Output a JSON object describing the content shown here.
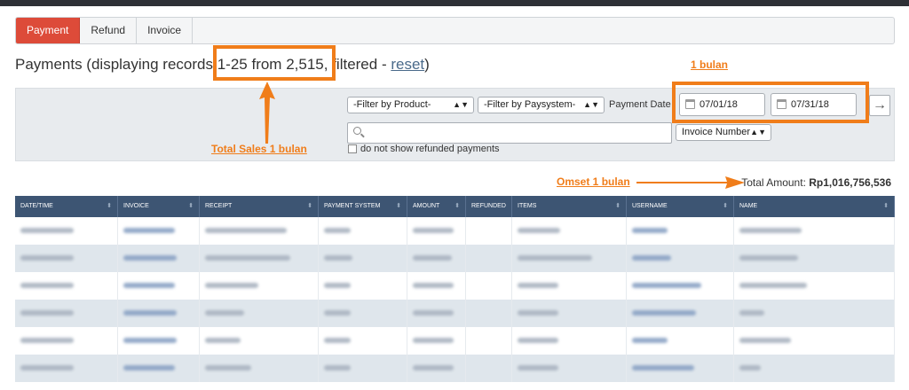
{
  "tabs": [
    {
      "label": "Payment",
      "active": true
    },
    {
      "label": "Refund",
      "active": false
    },
    {
      "label": "Invoice",
      "active": false
    }
  ],
  "title": {
    "prefix": "Payments (displaying records ",
    "range": "1-25 from 2,515,",
    "suffix": " filtered - ",
    "reset_link": "reset",
    "close": ")"
  },
  "filters": {
    "product_select": "-Filter by Product-",
    "paysystem_select": "-Filter by Paysystem-",
    "payment_date_label": "Payment Date",
    "date_from": "07/01/18",
    "date_to": "07/31/18",
    "search_value": "",
    "search_field_select": "Invoice Number",
    "refund_checkbox_label": "do not show refunded payments",
    "refund_checkbox_checked": false
  },
  "annotations": {
    "one_month": "1 bulan",
    "total_sales": "Total Sales 1 bulan",
    "omset": "Omset 1 bulan",
    "color": "#f07d1a"
  },
  "summary": {
    "total_label": "Total Amount:",
    "total_value": "Rp1,016,756,536"
  },
  "table": {
    "columns": [
      "DATE/TIME",
      "INVOICE",
      "RECEIPT",
      "PAYMENT SYSTEM",
      "AMOUNT",
      "REFUNDED",
      "ITEMS",
      "USERNAME",
      "NAME"
    ],
    "header_color": "#3d5573",
    "rows_note_blurred": true
  },
  "colors": {
    "accent_tab": "#dd4b39",
    "link": "#4a6a8a"
  }
}
